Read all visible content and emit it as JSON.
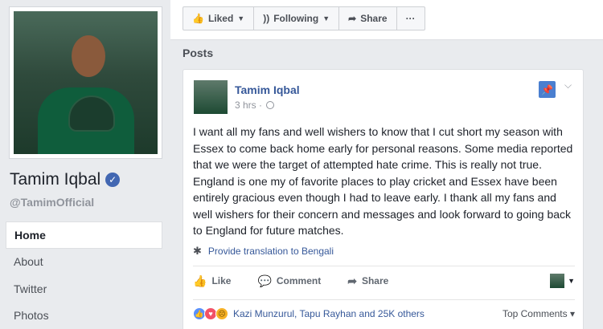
{
  "profile": {
    "name": "Tamim Iqbal",
    "handle": "@TamimOfficial"
  },
  "nav": {
    "items": [
      {
        "label": "Home",
        "active": true
      },
      {
        "label": "About",
        "active": false
      },
      {
        "label": "Twitter",
        "active": false
      },
      {
        "label": "Photos",
        "active": false
      }
    ]
  },
  "action_bar": {
    "liked": "Liked",
    "following": "Following",
    "share": "Share",
    "more": "···"
  },
  "posts_title": "Posts",
  "post": {
    "author": "Tamim Iqbal",
    "time": "3 hrs ·",
    "text": "I want all my fans and well wishers to know that I cut short my season with Essex to come back home early for personal reasons. Some media reported that we were the target of attempted hate crime. This is really not true. England is one my of favorite places to play cricket and Essex have been entirely gracious even though I had to leave early. I thank all my fans and well wishers for their concern and messages and look forward to going back to England for future matches.",
    "translate": "Provide translation to Bengali",
    "like_label": "Like",
    "comment_label": "Comment",
    "share_label": "Share",
    "reactors": "Kazi Munzurul, Tapu Rayhan and 25K others",
    "top_comments": "Top Comments ▾"
  },
  "colors": {
    "link_blue": "#365899",
    "brand_blue": "#4267b2",
    "background": "#e9ebee"
  }
}
